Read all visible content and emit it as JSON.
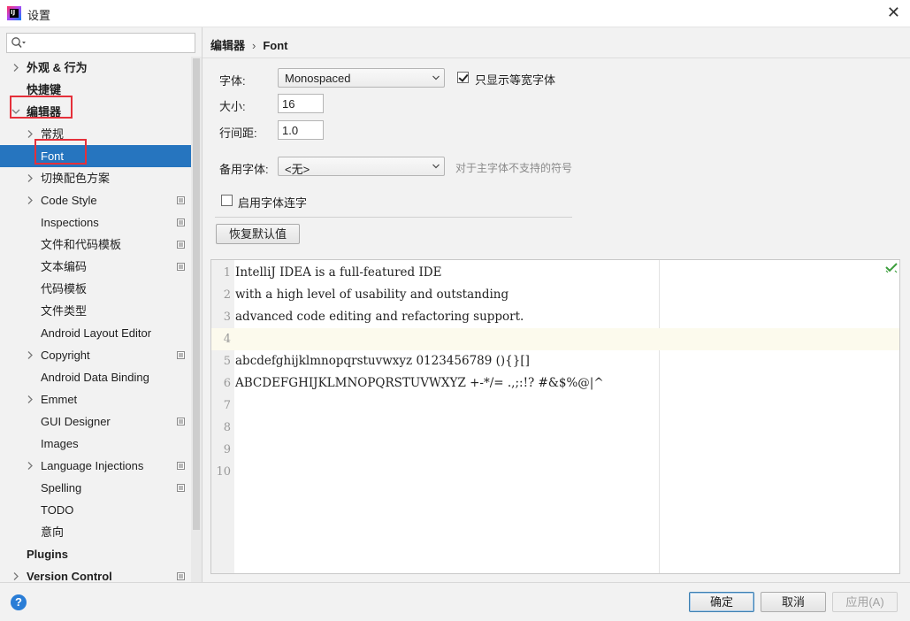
{
  "window": {
    "title": "设置",
    "close_glyph": "✕",
    "app_icon_text": "IJ"
  },
  "sidebar": {
    "search_placeholder": "",
    "items": [
      {
        "label": "外观 & 行为",
        "level": 0,
        "expandable": true,
        "expanded": false,
        "bold": true,
        "project": false
      },
      {
        "label": "快捷键",
        "level": 0,
        "expandable": false,
        "bold": true,
        "project": false
      },
      {
        "label": "编辑器",
        "level": 0,
        "expandable": true,
        "expanded": true,
        "bold": true,
        "project": false,
        "highlighted": true
      },
      {
        "label": "常规",
        "level": 1,
        "expandable": true,
        "expanded": false,
        "bold": false,
        "project": false
      },
      {
        "label": "Font",
        "level": 1,
        "expandable": false,
        "bold": false,
        "project": false,
        "selected": true,
        "highlighted": true
      },
      {
        "label": "切换配色方案",
        "level": 1,
        "expandable": true,
        "expanded": false,
        "bold": false,
        "project": false
      },
      {
        "label": "Code Style",
        "level": 1,
        "expandable": true,
        "expanded": false,
        "bold": false,
        "project": true
      },
      {
        "label": "Inspections",
        "level": 1,
        "expandable": false,
        "bold": false,
        "project": true
      },
      {
        "label": "文件和代码模板",
        "level": 1,
        "expandable": false,
        "bold": false,
        "project": true
      },
      {
        "label": "文本编码",
        "level": 1,
        "expandable": false,
        "bold": false,
        "project": true
      },
      {
        "label": "代码模板",
        "level": 1,
        "expandable": false,
        "bold": false,
        "project": false
      },
      {
        "label": "文件类型",
        "level": 1,
        "expandable": false,
        "bold": false,
        "project": false
      },
      {
        "label": "Android Layout Editor",
        "level": 1,
        "expandable": false,
        "bold": false,
        "project": false
      },
      {
        "label": "Copyright",
        "level": 1,
        "expandable": true,
        "expanded": false,
        "bold": false,
        "project": true
      },
      {
        "label": "Android Data Binding",
        "level": 1,
        "expandable": false,
        "bold": false,
        "project": false
      },
      {
        "label": "Emmet",
        "level": 1,
        "expandable": true,
        "expanded": false,
        "bold": false,
        "project": false
      },
      {
        "label": "GUI Designer",
        "level": 1,
        "expandable": false,
        "bold": false,
        "project": true
      },
      {
        "label": "Images",
        "level": 1,
        "expandable": false,
        "bold": false,
        "project": false
      },
      {
        "label": "Language Injections",
        "level": 1,
        "expandable": true,
        "expanded": false,
        "bold": false,
        "project": true
      },
      {
        "label": "Spelling",
        "level": 1,
        "expandable": false,
        "bold": false,
        "project": true
      },
      {
        "label": "TODO",
        "level": 1,
        "expandable": false,
        "bold": false,
        "project": false
      },
      {
        "label": "意向",
        "level": 1,
        "expandable": false,
        "bold": false,
        "project": false
      },
      {
        "label": "Plugins",
        "level": 0,
        "expandable": false,
        "bold": true,
        "project": false
      },
      {
        "label": "Version Control",
        "level": 0,
        "expandable": true,
        "expanded": false,
        "bold": true,
        "project": true
      }
    ]
  },
  "breadcrumb": {
    "parent": "编辑器",
    "separator": "›",
    "current": "Font"
  },
  "font_settings": {
    "font_label": "字体:",
    "font_value": "Monospaced",
    "monospace_only_label": "只显示等宽字体",
    "monospace_only_checked": true,
    "size_label": "大小:",
    "size_value": "16",
    "line_spacing_label": "行间距:",
    "line_spacing_value": "1.0",
    "fallback_label": "备用字体:",
    "fallback_value": "<无>",
    "fallback_hint": "对于主字体不支持的符号",
    "ligatures_label": "启用字体连字",
    "ligatures_checked": false,
    "restore_defaults_label": "恢复默认值"
  },
  "preview": {
    "current_line": 4,
    "lines": [
      {
        "num": "1",
        "text": "IntelliJ IDEA is a full-featured IDE"
      },
      {
        "num": "2",
        "text": "with a high level of usability and outstanding"
      },
      {
        "num": "3",
        "text": "advanced code editing and refactoring support."
      },
      {
        "num": "4",
        "text": ""
      },
      {
        "num": "5",
        "text": "abcdefghijklmnopqrstuvwxyz 0123456789 (){}[]"
      },
      {
        "num": "6",
        "text": "ABCDEFGHIJKLMNOPQRSTUVWXYZ +-*/= .,;:!? #&$%@|^"
      },
      {
        "num": "7",
        "text": ""
      },
      {
        "num": "8",
        "text": ""
      },
      {
        "num": "9",
        "text": ""
      },
      {
        "num": "10",
        "text": ""
      }
    ]
  },
  "footer": {
    "help_glyph": "?",
    "ok_label": "确定",
    "cancel_label": "取消",
    "apply_label": "应用(A)"
  },
  "colors": {
    "selection": "#2675bf",
    "highlight_box": "#e5303a",
    "current_line": "#fcfaed",
    "check_green": "#3c9e3c"
  }
}
